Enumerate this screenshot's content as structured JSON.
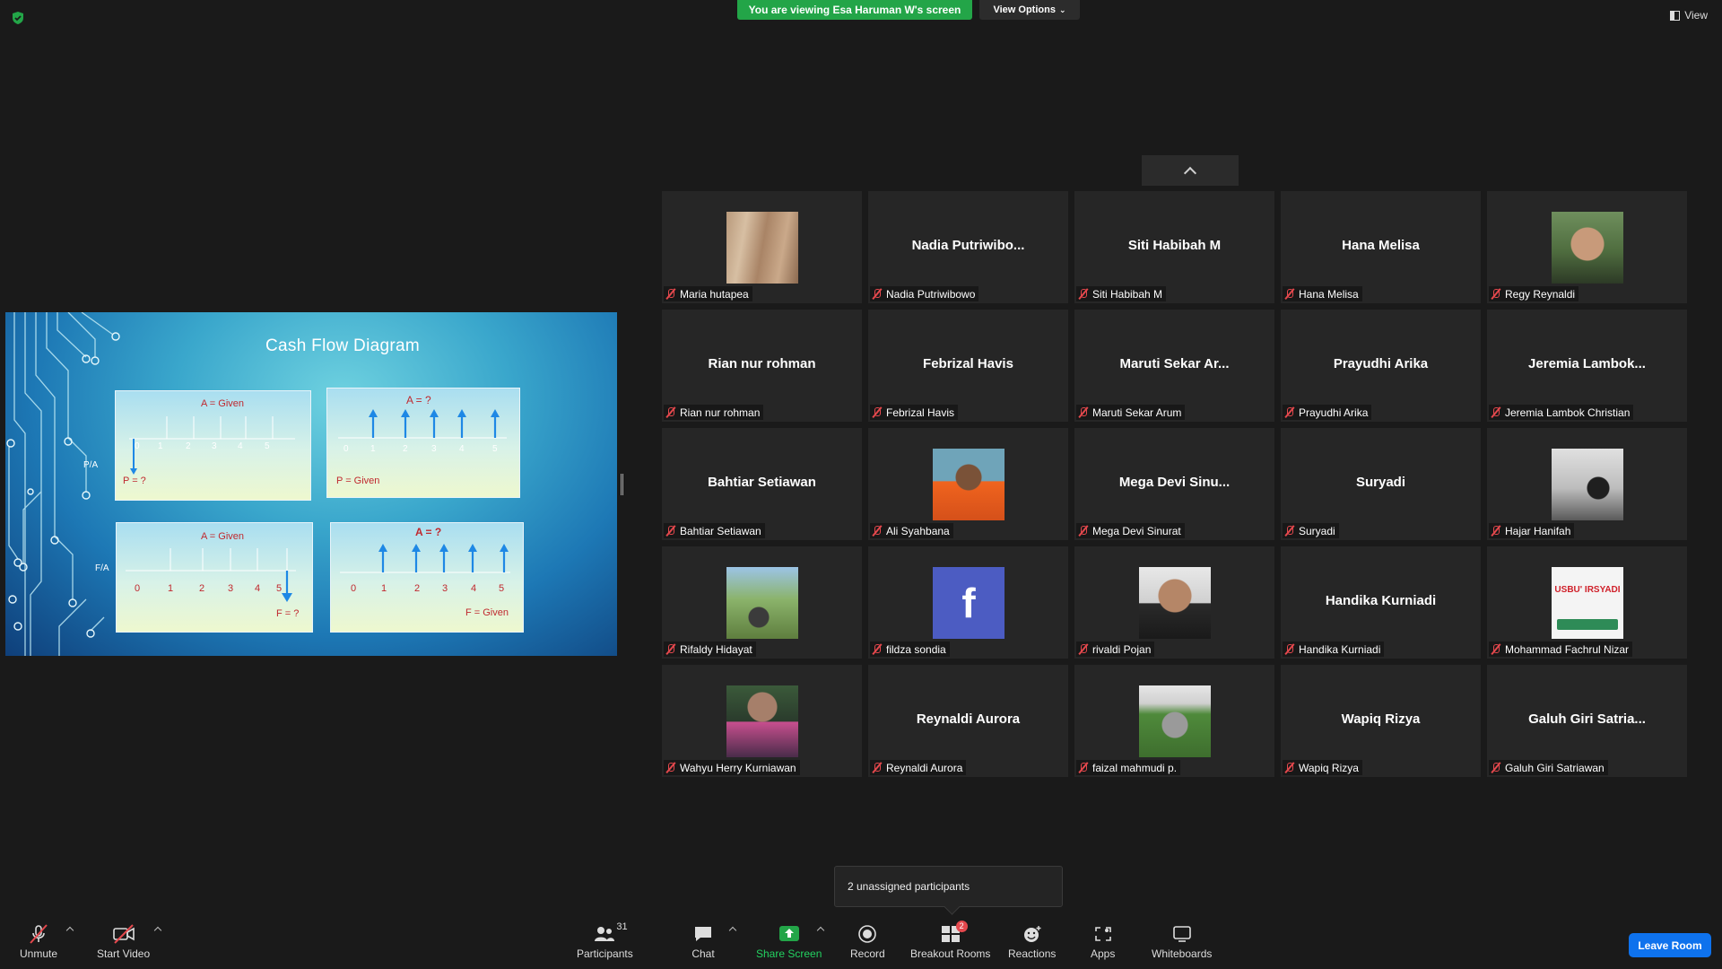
{
  "banner": {
    "viewing_text": "You are viewing Esa Haruman W's screen",
    "view_options_label": "View Options",
    "view_label": "View"
  },
  "slide": {
    "title": "Cash Flow Diagram",
    "panel_tl": {
      "top_label": "A = Given",
      "bottom_label": "P = ?",
      "side_label": "P/A",
      "ticks": [
        "0",
        "1",
        "2",
        "3",
        "4",
        "5"
      ]
    },
    "panel_tr": {
      "top_label": "A = ?",
      "bottom_label": "P = Given",
      "ticks": [
        "0",
        "1",
        "2",
        "3",
        "4",
        "5"
      ]
    },
    "panel_bl": {
      "top_label": "A = Given",
      "bottom_label": "F = ?",
      "side_label": "F/A",
      "ticks": [
        "0",
        "1",
        "2",
        "3",
        "4",
        "5"
      ]
    },
    "panel_br": {
      "top_label": "A = ?",
      "bottom_label": "F = Given",
      "ticks": [
        "0",
        "1",
        "2",
        "3",
        "4",
        "5"
      ]
    }
  },
  "participants": [
    {
      "name": "Maria hutapea",
      "big": "",
      "thumb": "thumb-wood"
    },
    {
      "name": "Nadia Putriwibowo",
      "big": "Nadia  Putriwibo...",
      "thumb": ""
    },
    {
      "name": "Siti Habibah M",
      "big": "Siti Habibah M",
      "thumb": ""
    },
    {
      "name": "Hana Melisa",
      "big": "Hana Melisa",
      "thumb": ""
    },
    {
      "name": "Regy Reynaldi",
      "big": "",
      "thumb": "thumb-regy"
    },
    {
      "name": "Rian nur rohman",
      "big": "Rian nur rohman",
      "thumb": ""
    },
    {
      "name": "Febrizal Havis",
      "big": "Febrizal Havis",
      "thumb": ""
    },
    {
      "name": "Maruti Sekar Arum",
      "big": "Maruti  Sekar  Ar...",
      "thumb": ""
    },
    {
      "name": "Prayudhi Arika",
      "big": "Prayudhi Arika",
      "thumb": ""
    },
    {
      "name": "Jeremia Lambok Christian",
      "big": "Jeremia  Lambok...",
      "thumb": ""
    },
    {
      "name": "Bahtiar Setiawan",
      "big": "Bahtiar Setiawan",
      "thumb": ""
    },
    {
      "name": "Ali Syahbana",
      "big": "",
      "thumb": "thumb-ali"
    },
    {
      "name": "Mega Devi Sinurat",
      "big": "Mega  Devi  Sinu...",
      "thumb": ""
    },
    {
      "name": "Suryadi",
      "big": "Suryadi",
      "thumb": ""
    },
    {
      "name": "Hajar Hanifah",
      "big": "",
      "thumb": "thumb-hajar"
    },
    {
      "name": "Rifaldy Hidayat",
      "big": "",
      "thumb": "thumb-rifaldy"
    },
    {
      "name": "fildza sondia",
      "big": "",
      "thumb": "thumb-fb"
    },
    {
      "name": "rivaldi Pojan",
      "big": "",
      "thumb": "thumb-rivaldi"
    },
    {
      "name": "Handika Kurniadi",
      "big": "Handika Kurniadi",
      "thumb": ""
    },
    {
      "name": "Mohammad Fachrul Nizar",
      "big": "",
      "thumb": "thumb-usbu"
    },
    {
      "name": "Wahyu Herry Kurniawan",
      "big": "",
      "thumb": "thumb-wahyu"
    },
    {
      "name": "Reynaldi Aurora",
      "big": "Reynaldi Aurora",
      "thumb": ""
    },
    {
      "name": "faizal mahmudi p.",
      "big": "",
      "thumb": "thumb-faizal"
    },
    {
      "name": "Wapiq Rizya",
      "big": "Wapiq Rizya",
      "thumb": ""
    },
    {
      "name": "Galuh Giri Satriawan",
      "big": "Galuh  Giri  Satria...",
      "thumb": ""
    }
  ],
  "usbu_text": "USBU' IRSYADI",
  "fb_letter": "f",
  "tooltip": "2 unassigned participants",
  "toolbar": {
    "unmute": "Unmute",
    "start_video": "Start Video",
    "participants": "Participants",
    "participants_count": "31",
    "chat": "Chat",
    "share_screen": "Share Screen",
    "record": "Record",
    "breakout_rooms": "Breakout Rooms",
    "breakout_badge": "2",
    "reactions": "Reactions",
    "apps": "Apps",
    "whiteboards": "Whiteboards",
    "leave": "Leave Room"
  },
  "colors": {
    "share_green": "#23a548",
    "leave_blue": "#0e72ed",
    "mute_red": "#e5484d",
    "slide_text_red": "#c0282e",
    "slide_arrow_blue": "#1e88e5"
  }
}
